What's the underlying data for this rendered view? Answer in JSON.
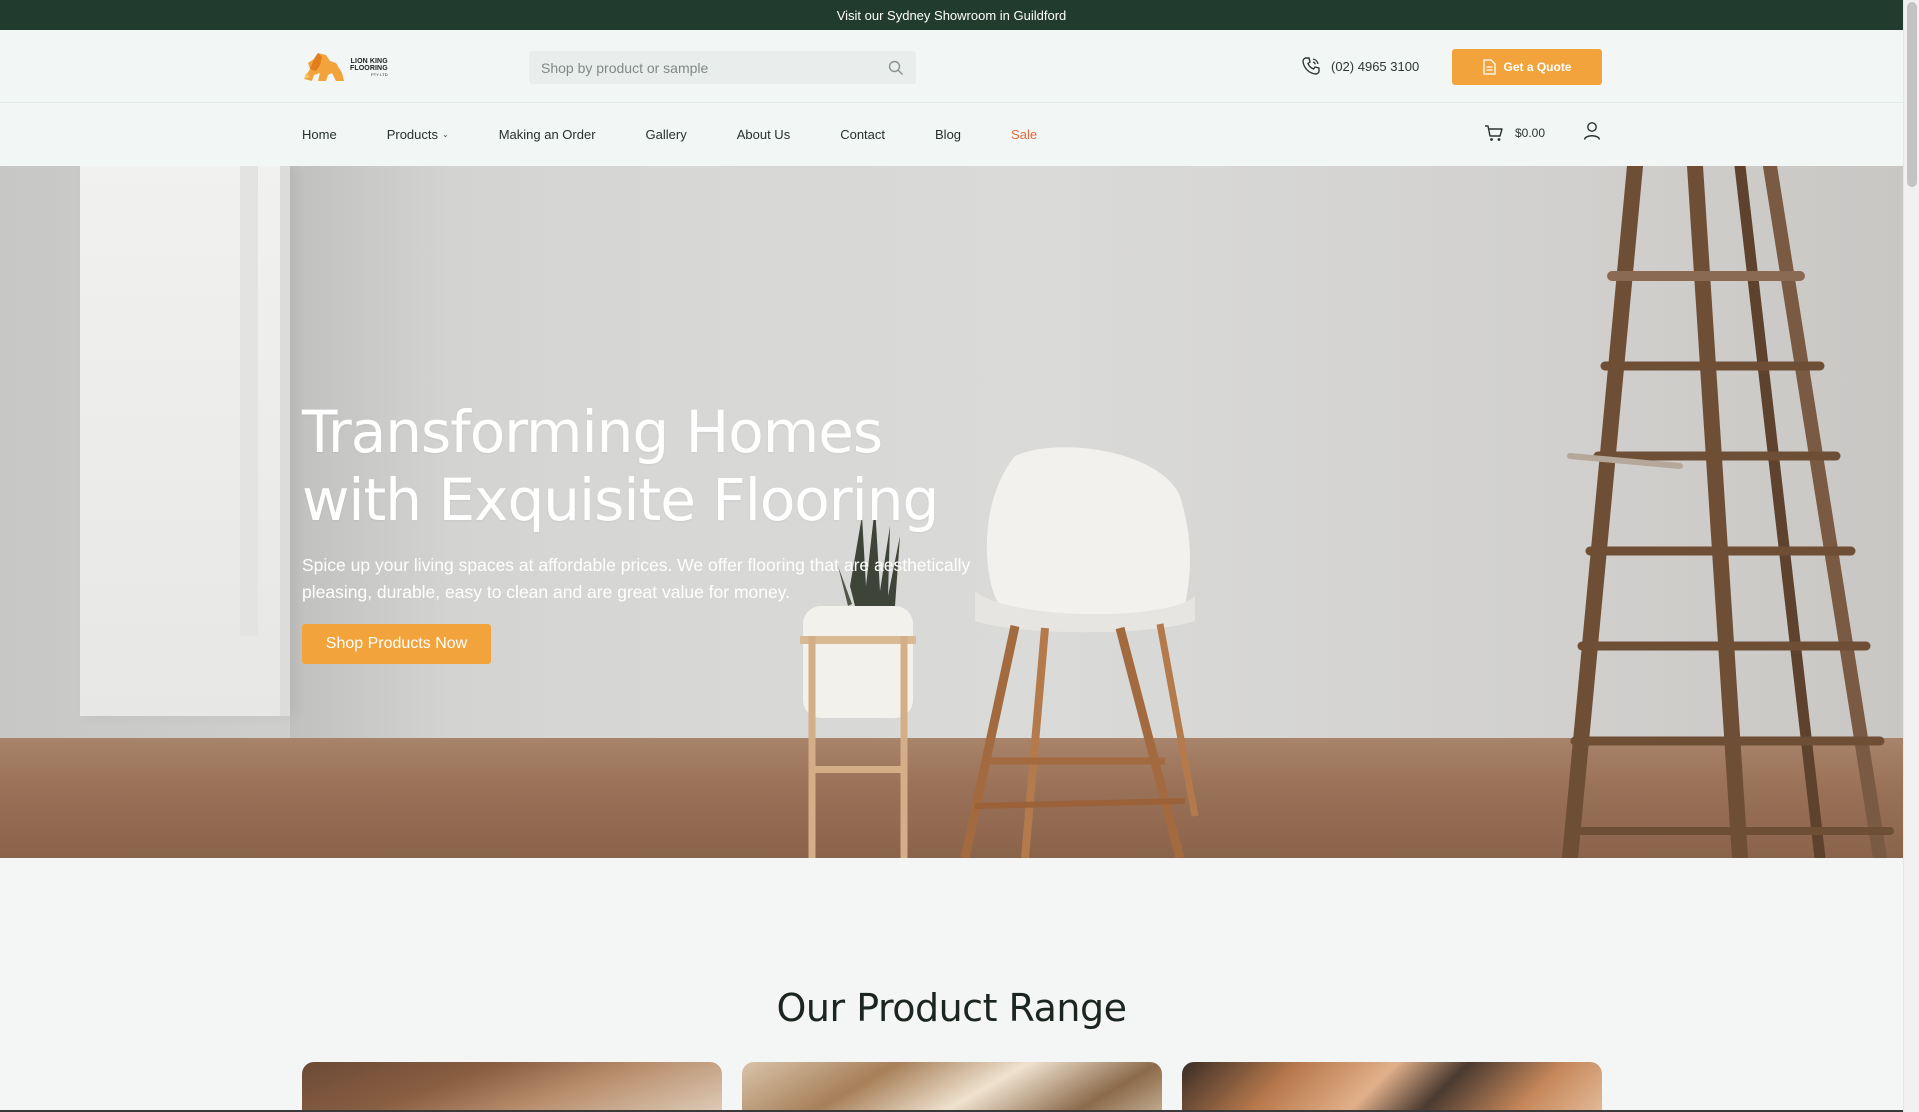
{
  "announcement": "Visit our Sydney Showroom in Guildford",
  "logo": {
    "line1": "LION KING",
    "line2": "FLOORING",
    "line3": "PTY LTD"
  },
  "search": {
    "placeholder": "Shop by product or sample"
  },
  "phone": "(02) 4965 3100",
  "quote_button": "Get a Quote",
  "nav": {
    "items": [
      "Home",
      "Products",
      "Making an Order",
      "Gallery",
      "About Us",
      "Contact",
      "Blog",
      "Sale"
    ]
  },
  "cart": {
    "total": "$0.00"
  },
  "hero": {
    "title_line1": "Transforming Homes",
    "title_line2": "with Exquisite Flooring",
    "subtitle": "Spice up your living spaces at affordable prices. We offer flooring that are aesthetically pleasing, durable, easy to clean and are great value for money.",
    "button": "Shop Products Now"
  },
  "range": {
    "heading": "Our Product Range"
  },
  "colors": {
    "announcement_bg": "#223b2f",
    "accent": "#f2a33c",
    "sale": "#e8663d",
    "header_bg": "#f2f7f5"
  },
  "icons": {
    "search": "search-icon",
    "phone": "phone-icon",
    "quote": "document-icon",
    "cart": "cart-icon",
    "user": "user-icon",
    "chevron": "chevron-down-icon"
  }
}
